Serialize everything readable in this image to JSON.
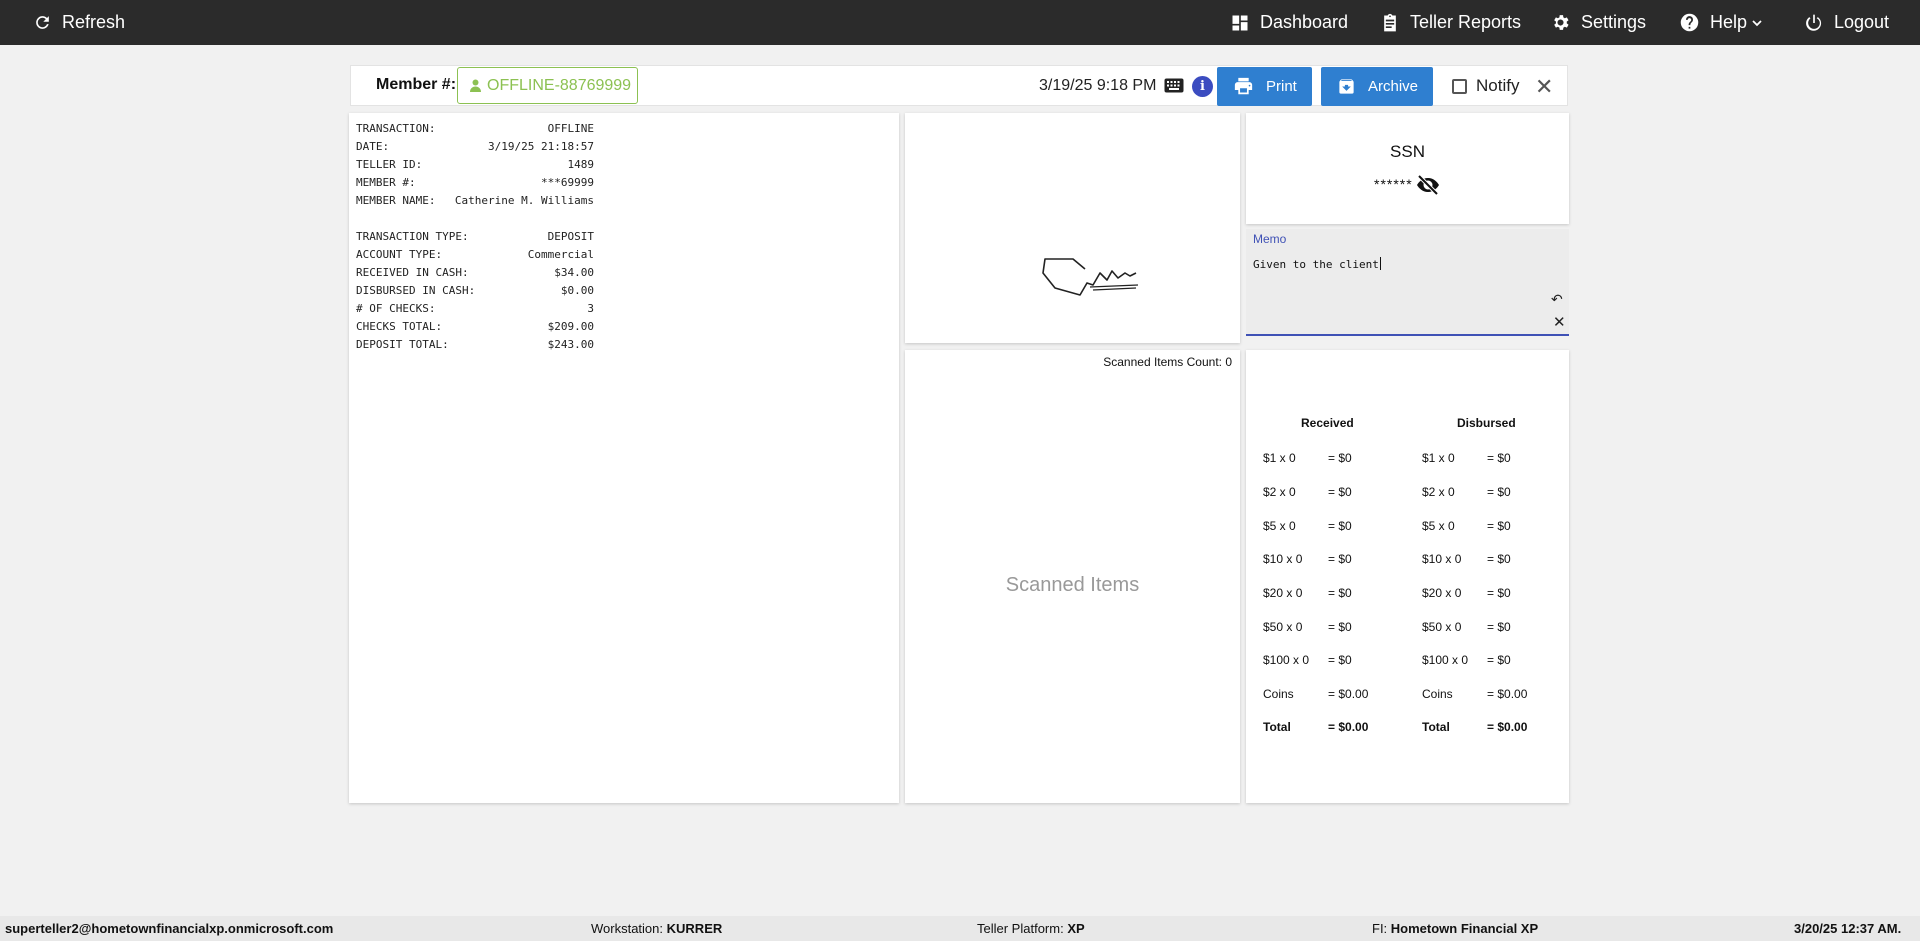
{
  "nav": {
    "refresh": "Refresh",
    "dashboard": "Dashboard",
    "teller_reports": "Teller Reports",
    "settings": "Settings",
    "help": "Help",
    "logout": "Logout"
  },
  "header": {
    "member_label": "Member #:",
    "member_value": "OFFLINE-88769999",
    "datetime": "3/19/25 9:18 PM",
    "print": "Print",
    "archive": "Archive",
    "notify": "Notify"
  },
  "receipt": {
    "lines": [
      [
        "TRANSACTION:",
        "OFFLINE"
      ],
      [
        "DATE:",
        "3/19/25 21:18:57"
      ],
      [
        "TELLER ID:",
        "1489"
      ],
      [
        "MEMBER #:",
        "***69999"
      ],
      [
        "MEMBER NAME:",
        "Catherine M. Williams"
      ]
    ],
    "lines2": [
      [
        "TRANSACTION TYPE:",
        "DEPOSIT"
      ],
      [
        "ACCOUNT TYPE:",
        "Commercial"
      ],
      [
        "RECEIVED IN CASH:",
        "$34.00"
      ],
      [
        "DISBURSED IN CASH:",
        "$0.00"
      ],
      [
        "# OF CHECKS:",
        "3"
      ],
      [
        "CHECKS TOTAL:",
        "$209.00"
      ],
      [
        "DEPOSIT TOTAL:",
        "$243.00"
      ]
    ]
  },
  "ssn": {
    "title": "SSN",
    "masked": "******"
  },
  "memo": {
    "label": "Memo",
    "value": "Given to the client"
  },
  "scans": {
    "count_label": "Scanned Items Count: 0",
    "placeholder": "Scanned Items"
  },
  "cash": {
    "received_header": "Received",
    "disbursed_header": "Disbursed",
    "received": [
      [
        "$1 x 0",
        "= $0"
      ],
      [
        "$2 x 0",
        "= $0"
      ],
      [
        "$5 x 0",
        "= $0"
      ],
      [
        "$10 x 0",
        "= $0"
      ],
      [
        "$20 x 0",
        "= $0"
      ],
      [
        "$50 x 0",
        "= $0"
      ],
      [
        "$100 x 0",
        "= $0"
      ],
      [
        "Coins",
        "= $0.00"
      ],
      [
        "Total",
        "= $0.00"
      ]
    ],
    "disbursed": [
      [
        "$1 x 0",
        "= $0"
      ],
      [
        "$2 x 0",
        "= $0"
      ],
      [
        "$5 x 0",
        "= $0"
      ],
      [
        "$10 x 0",
        "= $0"
      ],
      [
        "$20 x 0",
        "= $0"
      ],
      [
        "$50 x 0",
        "= $0"
      ],
      [
        "$100 x 0",
        "= $0"
      ],
      [
        "Coins",
        "= $0.00"
      ],
      [
        "Total",
        "= $0.00"
      ]
    ]
  },
  "footer": {
    "user": "superteller2@hometownfinancialxp.onmicrosoft.com",
    "workstation_label": "Workstation:",
    "workstation": "KURRER",
    "platform_label": "Teller Platform:",
    "platform": "XP",
    "fi_label": "FI:",
    "fi": "Hometown Financial XP",
    "timestamp": "3/20/25 12:37 AM."
  },
  "colors": {
    "topbar": "#2b2b2b",
    "accent_blue": "#2f7fd0",
    "member_green": "#8cc152",
    "memo_underline": "#3f51b5"
  }
}
